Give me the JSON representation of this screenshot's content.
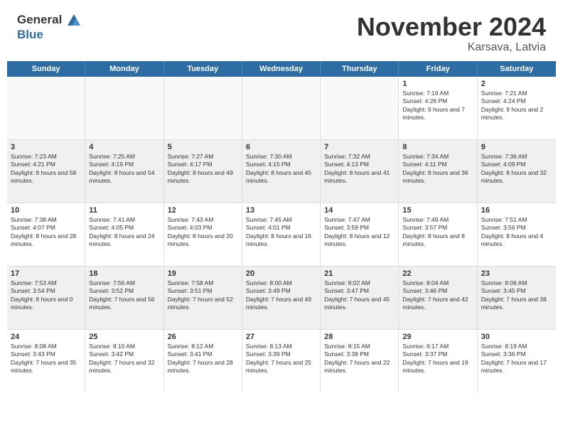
{
  "header": {
    "logo_general": "General",
    "logo_blue": "Blue",
    "month_title": "November 2024",
    "location": "Karsava, Latvia"
  },
  "weekdays": [
    "Sunday",
    "Monday",
    "Tuesday",
    "Wednesday",
    "Thursday",
    "Friday",
    "Saturday"
  ],
  "weeks": [
    [
      {
        "day": "",
        "empty": true
      },
      {
        "day": "",
        "empty": true
      },
      {
        "day": "",
        "empty": true
      },
      {
        "day": "",
        "empty": true
      },
      {
        "day": "",
        "empty": true
      },
      {
        "day": "1",
        "sunrise": "7:19 AM",
        "sunset": "4:26 PM",
        "daylight": "9 hours and 7 minutes."
      },
      {
        "day": "2",
        "sunrise": "7:21 AM",
        "sunset": "4:24 PM",
        "daylight": "9 hours and 2 minutes."
      }
    ],
    [
      {
        "day": "3",
        "sunrise": "7:23 AM",
        "sunset": "4:21 PM",
        "daylight": "8 hours and 58 minutes."
      },
      {
        "day": "4",
        "sunrise": "7:25 AM",
        "sunset": "4:19 PM",
        "daylight": "8 hours and 54 minutes."
      },
      {
        "day": "5",
        "sunrise": "7:27 AM",
        "sunset": "4:17 PM",
        "daylight": "8 hours and 49 minutes."
      },
      {
        "day": "6",
        "sunrise": "7:30 AM",
        "sunset": "4:15 PM",
        "daylight": "8 hours and 45 minutes."
      },
      {
        "day": "7",
        "sunrise": "7:32 AM",
        "sunset": "4:13 PM",
        "daylight": "8 hours and 41 minutes."
      },
      {
        "day": "8",
        "sunrise": "7:34 AM",
        "sunset": "4:11 PM",
        "daylight": "8 hours and 36 minutes."
      },
      {
        "day": "9",
        "sunrise": "7:36 AM",
        "sunset": "4:09 PM",
        "daylight": "8 hours and 32 minutes."
      }
    ],
    [
      {
        "day": "10",
        "sunrise": "7:38 AM",
        "sunset": "4:07 PM",
        "daylight": "8 hours and 28 minutes."
      },
      {
        "day": "11",
        "sunrise": "7:41 AM",
        "sunset": "4:05 PM",
        "daylight": "8 hours and 24 minutes."
      },
      {
        "day": "12",
        "sunrise": "7:43 AM",
        "sunset": "4:03 PM",
        "daylight": "8 hours and 20 minutes."
      },
      {
        "day": "13",
        "sunrise": "7:45 AM",
        "sunset": "4:01 PM",
        "daylight": "8 hours and 16 minutes."
      },
      {
        "day": "14",
        "sunrise": "7:47 AM",
        "sunset": "3:59 PM",
        "daylight": "8 hours and 12 minutes."
      },
      {
        "day": "15",
        "sunrise": "7:49 AM",
        "sunset": "3:57 PM",
        "daylight": "8 hours and 8 minutes."
      },
      {
        "day": "16",
        "sunrise": "7:51 AM",
        "sunset": "3:56 PM",
        "daylight": "8 hours and 4 minutes."
      }
    ],
    [
      {
        "day": "17",
        "sunrise": "7:53 AM",
        "sunset": "3:54 PM",
        "daylight": "8 hours and 0 minutes."
      },
      {
        "day": "18",
        "sunrise": "7:56 AM",
        "sunset": "3:52 PM",
        "daylight": "7 hours and 56 minutes."
      },
      {
        "day": "19",
        "sunrise": "7:58 AM",
        "sunset": "3:51 PM",
        "daylight": "7 hours and 52 minutes."
      },
      {
        "day": "20",
        "sunrise": "8:00 AM",
        "sunset": "3:49 PM",
        "daylight": "7 hours and 49 minutes."
      },
      {
        "day": "21",
        "sunrise": "8:02 AM",
        "sunset": "3:47 PM",
        "daylight": "7 hours and 45 minutes."
      },
      {
        "day": "22",
        "sunrise": "8:04 AM",
        "sunset": "3:46 PM",
        "daylight": "7 hours and 42 minutes."
      },
      {
        "day": "23",
        "sunrise": "8:06 AM",
        "sunset": "3:45 PM",
        "daylight": "7 hours and 38 minutes."
      }
    ],
    [
      {
        "day": "24",
        "sunrise": "8:08 AM",
        "sunset": "3:43 PM",
        "daylight": "7 hours and 35 minutes."
      },
      {
        "day": "25",
        "sunrise": "8:10 AM",
        "sunset": "3:42 PM",
        "daylight": "7 hours and 32 minutes."
      },
      {
        "day": "26",
        "sunrise": "8:12 AM",
        "sunset": "3:41 PM",
        "daylight": "7 hours and 28 minutes."
      },
      {
        "day": "27",
        "sunrise": "8:13 AM",
        "sunset": "3:39 PM",
        "daylight": "7 hours and 25 minutes."
      },
      {
        "day": "28",
        "sunrise": "8:15 AM",
        "sunset": "3:38 PM",
        "daylight": "7 hours and 22 minutes."
      },
      {
        "day": "29",
        "sunrise": "8:17 AM",
        "sunset": "3:37 PM",
        "daylight": "7 hours and 19 minutes."
      },
      {
        "day": "30",
        "sunrise": "8:19 AM",
        "sunset": "3:36 PM",
        "daylight": "7 hours and 17 minutes."
      }
    ]
  ]
}
